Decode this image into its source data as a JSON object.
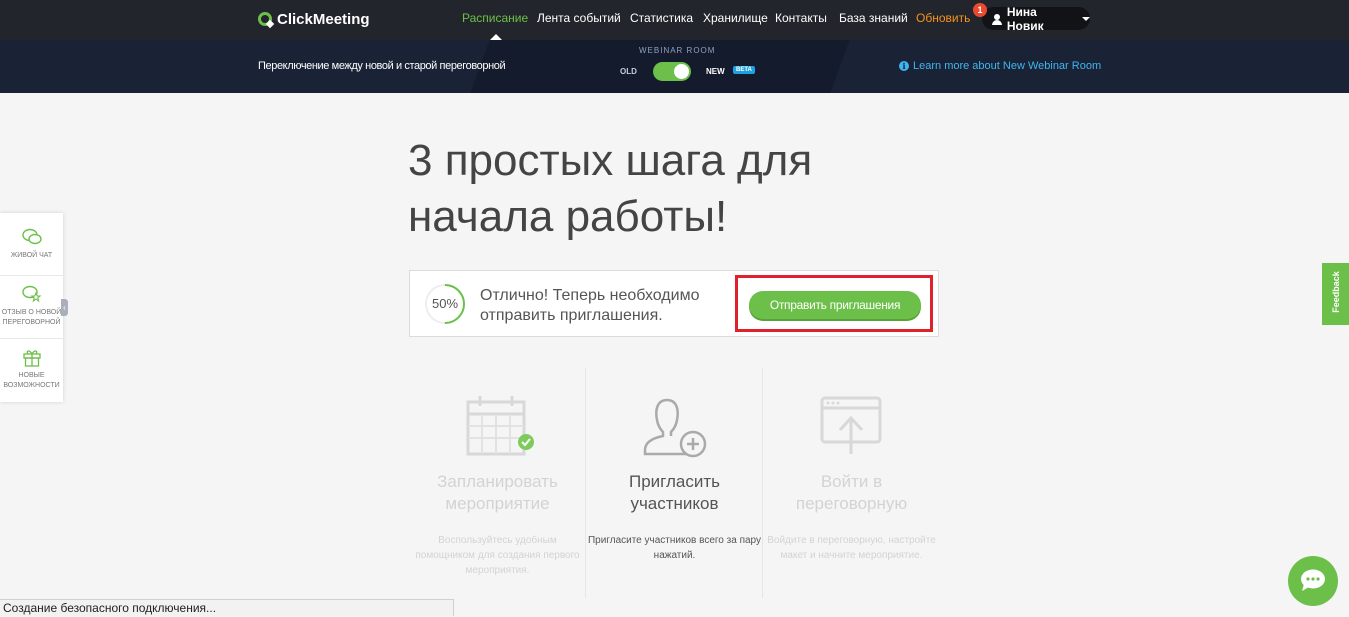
{
  "header": {
    "logo": "ClickMeeting",
    "nav": [
      {
        "label": "Расписание",
        "active": true
      },
      {
        "label": "Лента событий"
      },
      {
        "label": "Статистика"
      },
      {
        "label": "Хранилище"
      },
      {
        "label": "Контакты"
      },
      {
        "label": "База знаний"
      },
      {
        "label": "Обновить",
        "highlight": true
      }
    ],
    "notification_count": "1",
    "user_name": "Нина Новик"
  },
  "banner": {
    "switch_text": "Переключение между новой и старой переговорной",
    "room_label": "WEBINAR ROOM",
    "old_label": "OLD",
    "new_label": "NEW",
    "beta_label": "BETA",
    "learn_more": "Learn more about New Webinar Room"
  },
  "main": {
    "headline": "3 простых шага для начала работы!",
    "progress_value": "50%",
    "progress_fraction": 0.5,
    "message": "Отлично! Теперь необходимо отправить приглашения.",
    "invite_button": "Отправить приглашения"
  },
  "steps": [
    {
      "title": "Запланировать мероприятие",
      "desc": "Воспользуйтесь удобным помощником для создания первого мероприятия.",
      "state": "done"
    },
    {
      "title": "Пригласить участников",
      "desc": "Пригласите участников всего за пару нажатий.",
      "state": "active"
    },
    {
      "title": "Войти в переговорную",
      "desc": "Войдите в переговорную, настройте макет и начните мероприятие.",
      "state": "pending"
    }
  ],
  "side_widget": [
    {
      "label": "ЖИВОЙ ЧАТ"
    },
    {
      "label": "ОТЗЫВ О НОВОЙ ПЕРЕГОВОРНОЙ"
    },
    {
      "label": "НОВЫЕ ВОЗМОЖНОСТИ"
    }
  ],
  "feedback_tab": "Feedback",
  "status_bar": "Создание безопасного подключения...",
  "colors": {
    "accent": "#6cc04a",
    "header": "#22252b",
    "banner": "#1a2236",
    "highlight_border": "#e0202a",
    "link": "#3fb6f0",
    "update": "#f7931e"
  }
}
